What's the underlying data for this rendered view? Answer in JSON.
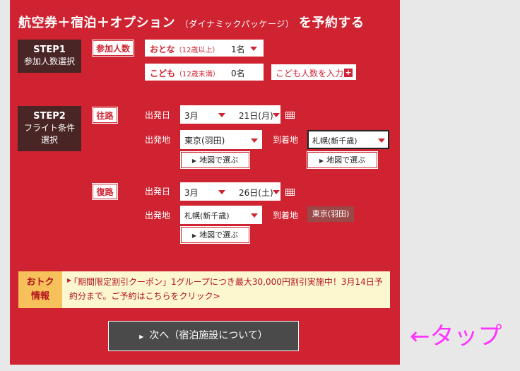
{
  "title": {
    "main": "航空券＋宿泊＋オプション",
    "sub": "（ダイナミックパッケージ）",
    "tail": "を予約する"
  },
  "step1": {
    "num": "STEP1",
    "label": "参加人数選択",
    "tag": "参加人数"
  },
  "adult": {
    "label": "おとな",
    "note": "（12歳以上）",
    "value": "1名"
  },
  "child": {
    "label": "こども",
    "note": "（12歳未満）",
    "value": "0名",
    "input_label": "こども人数を入力",
    "plus": "+"
  },
  "step2": {
    "num": "STEP2",
    "line1": "フライト条件",
    "line2": "選択"
  },
  "outbound": {
    "tag": "往路",
    "date_label": "出発日",
    "month": "3月",
    "day": "21日(月)",
    "from_label": "出発地",
    "from": "東京(羽田)",
    "to_label": "到着地",
    "to": "札幌(新千歳)",
    "map_label": "地図で選ぶ"
  },
  "return": {
    "tag": "復路",
    "date_label": "出発日",
    "month": "3月",
    "day": "26日(土)",
    "from_label": "出発地",
    "from": "札幌(新千歳)",
    "to_label": "到着地",
    "to": "東京(羽田)",
    "map_label": "地図で選ぶ"
  },
  "deal": {
    "badge_line1": "おトク",
    "badge_line2": "情報",
    "text": "「期間限定割引クーポン」1グループにつき最大30,000円割引実施中！3月14日予約分まで。ご予約はこちらをクリック>"
  },
  "next_button": "次へ（宿泊施設について）",
  "annotation": "←タップ",
  "colors": {
    "panel": "#cf2331",
    "step": "#4a2525",
    "deal_bg": "#fdf7cf",
    "badge": "#f6c05a",
    "annotation": "#ff33ff"
  }
}
